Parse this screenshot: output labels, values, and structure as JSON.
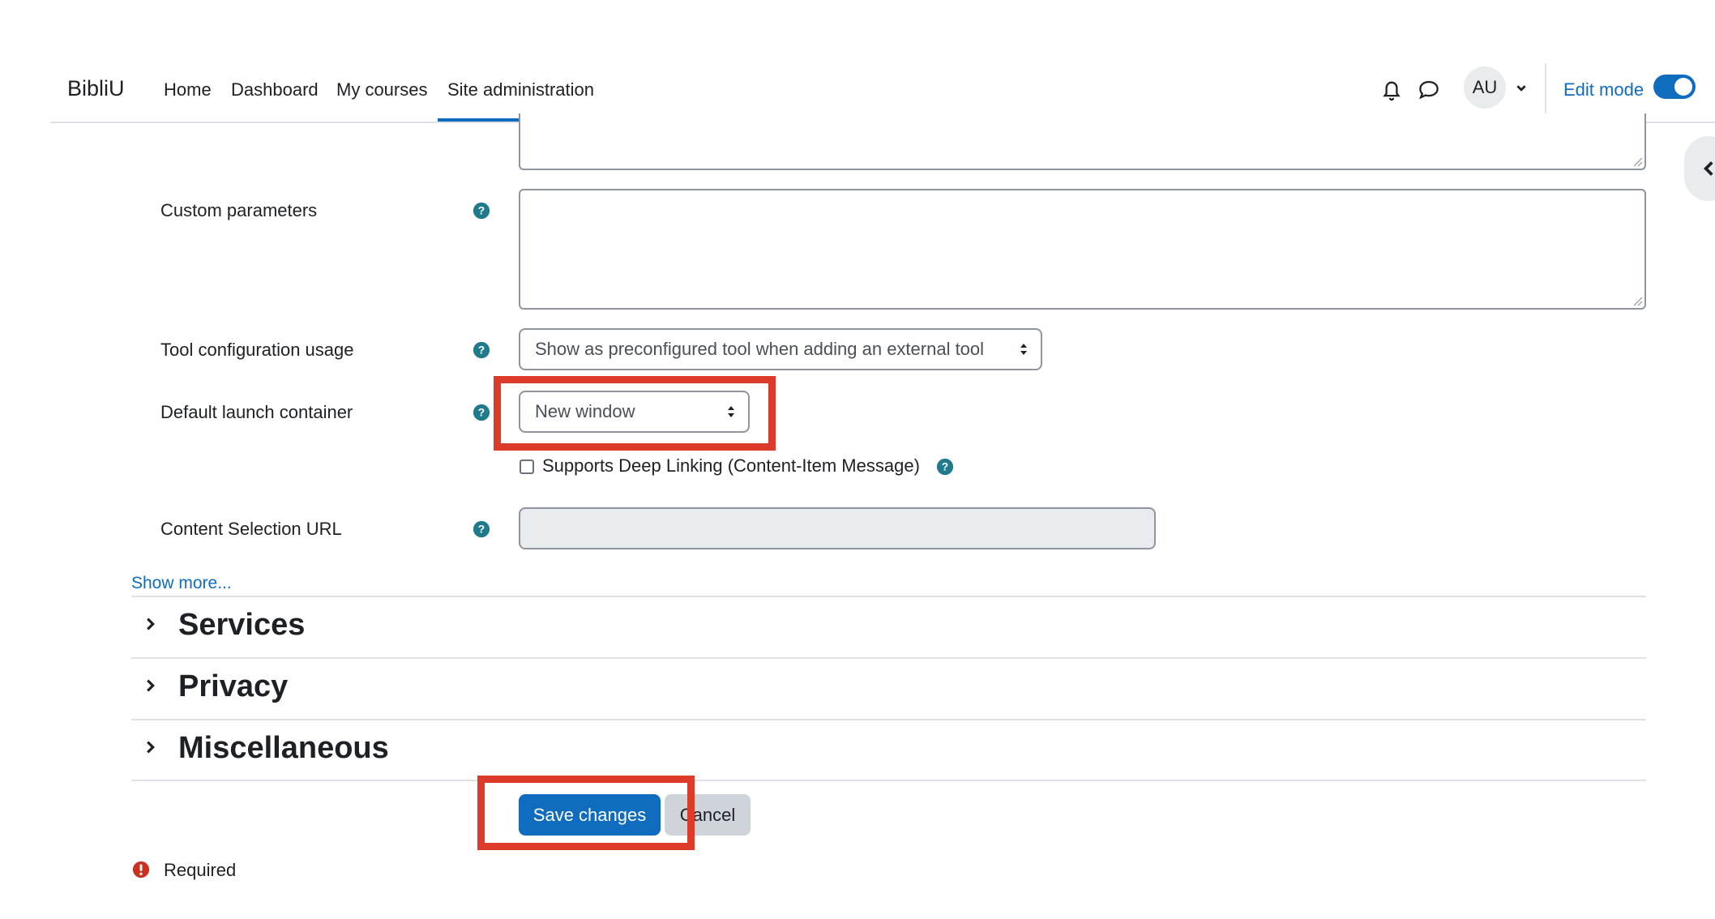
{
  "navbar": {
    "brand": "BibliU",
    "links": [
      "Home",
      "Dashboard",
      "My courses",
      "Site administration"
    ],
    "active_link": "Site administration",
    "avatar_initials": "AU",
    "edit_mode_label": "Edit mode",
    "edit_mode_on": true
  },
  "form": {
    "custom_parameters": {
      "label": "Custom parameters",
      "value": ""
    },
    "tool_config_usage": {
      "label": "Tool configuration usage",
      "selected": "Show as preconfigured tool when adding an external tool"
    },
    "launch_container": {
      "label": "Default launch container",
      "selected": "New window"
    },
    "deep_linking": {
      "label": "Supports Deep Linking (Content-Item Message)",
      "checked": false
    },
    "content_selection_url": {
      "label": "Content Selection URL",
      "value": ""
    },
    "show_more": "Show more..."
  },
  "sections": [
    "Services",
    "Privacy",
    "Miscellaneous"
  ],
  "buttons": {
    "save": "Save changes",
    "cancel": "Cancel"
  },
  "required_label": "Required",
  "colors": {
    "primary": "#0f6cbf",
    "highlight": "#dd3b2a",
    "required": "#ca3120",
    "help": "#1f7a8c"
  }
}
